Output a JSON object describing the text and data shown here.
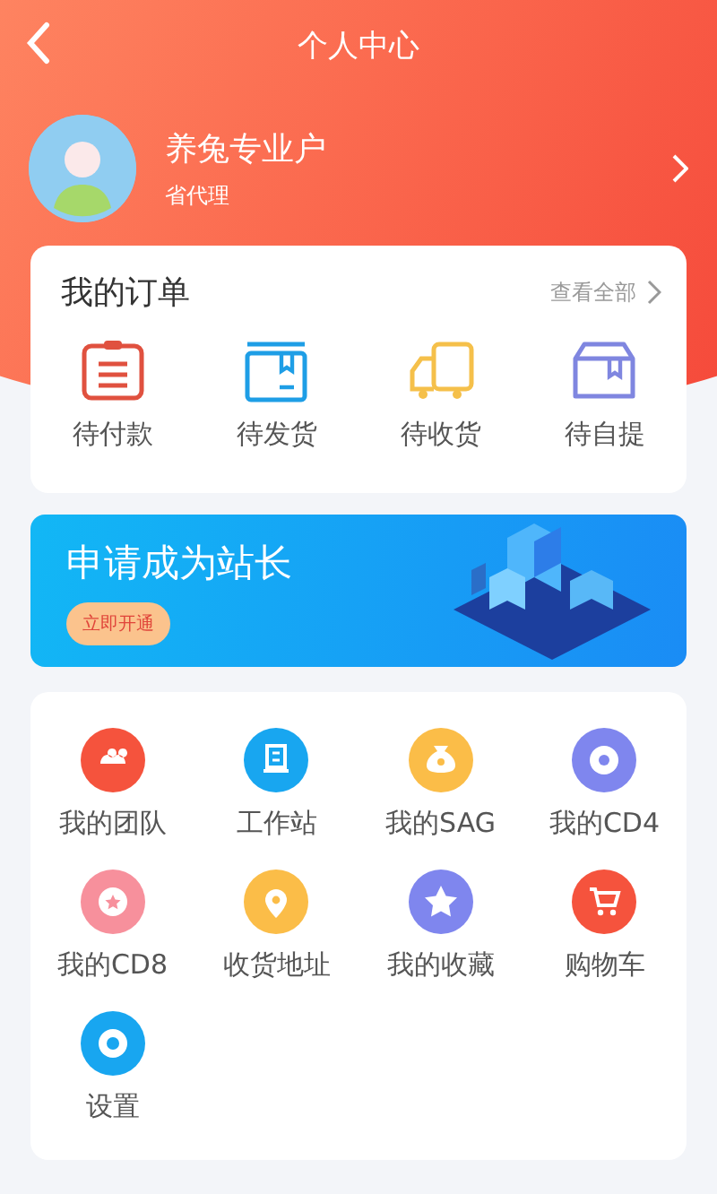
{
  "header": {
    "title": "个人中心"
  },
  "profile": {
    "name": "养兔专业户",
    "role": "省代理"
  },
  "orders": {
    "title": "我的订单",
    "view_all": "查看全部",
    "items": [
      {
        "label": "待付款"
      },
      {
        "label": "待发货"
      },
      {
        "label": "待收货"
      },
      {
        "label": "待自提"
      }
    ]
  },
  "banner": {
    "title": "申请成为站长",
    "button": "立即开通"
  },
  "services": [
    {
      "label": "我的团队",
      "color": "#f5533d"
    },
    {
      "label": "工作站",
      "color": "#18a6f0"
    },
    {
      "label": "我的SAG",
      "color": "#fbbd48"
    },
    {
      "label": "我的CD4",
      "color": "#7f86ee"
    },
    {
      "label": "我的CD8",
      "color": "#f7909c"
    },
    {
      "label": "收货地址",
      "color": "#fbbd48"
    },
    {
      "label": "我的收藏",
      "color": "#7f86ee"
    },
    {
      "label": "购物车",
      "color": "#f5533d"
    },
    {
      "label": "设置",
      "color": "#18a6f0"
    }
  ]
}
